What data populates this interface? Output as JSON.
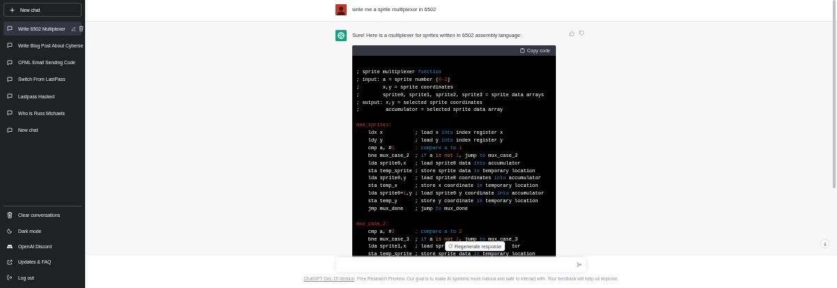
{
  "sidebar": {
    "new_chat_button": "New chat",
    "conversations": [
      {
        "title": "Write 6502 Multiplexer",
        "selected": true
      },
      {
        "title": "Write Blog Post About Cyberse",
        "selected": false
      },
      {
        "title": "CFML Email Sending Code",
        "selected": false
      },
      {
        "title": "Switch From LastPass",
        "selected": false
      },
      {
        "title": "Lastpass Hacked",
        "selected": false
      },
      {
        "title": "Who is Russ Michaels",
        "selected": false
      },
      {
        "title": "New chat",
        "selected": false
      }
    ],
    "footer_items": [
      {
        "label": "Clear conversations",
        "kind": "trash"
      },
      {
        "label": "Dark mode",
        "kind": "moon"
      },
      {
        "label": "OpenAI Discord",
        "kind": "discord"
      },
      {
        "label": "Updates & FAQ",
        "kind": "external"
      },
      {
        "label": "Log out",
        "kind": "logout"
      }
    ]
  },
  "messages": [
    {
      "kind": "user",
      "text": "write me a sprite multiplexor in 6502"
    },
    {
      "kind": "assistant",
      "text": "Sure! Here is a multiplexer for sprites written in 6502 assembly language:",
      "code": {
        "copy_label": "Copy code",
        "lines": [
          {
            "kind": "code",
            "segments": [
              {
                "text": "; sprite multiplexer ",
                "kind": "plain"
              },
              {
                "text": "function",
                "kind": "keyword"
              }
            ]
          },
          {
            "kind": "code",
            "segments": [
              {
                "text": "; input: a = sprite number (",
                "kind": "plain"
              },
              {
                "text": "0-3",
                "kind": "number"
              },
              {
                "text": ")",
                "kind": "plain"
              }
            ]
          },
          {
            "kind": "code",
            "segments": [
              {
                "text": ";        x,y = sprite coordinates",
                "kind": "plain"
              }
            ]
          },
          {
            "kind": "code",
            "segments": [
              {
                "text": ";        sprite0, sprite1, sprite2, sprite3 = sprite data arrays",
                "kind": "plain"
              }
            ]
          },
          {
            "kind": "code",
            "segments": [
              {
                "text": "; output: x,y = selected sprite coordinates",
                "kind": "plain"
              }
            ]
          },
          {
            "kind": "code",
            "segments": [
              {
                "text": ";         accumulator = selected sprite data array",
                "kind": "plain"
              }
            ]
          },
          {
            "kind": "blank"
          },
          {
            "kind": "code",
            "segments": [
              {
                "text": "mux_sprites:",
                "kind": "label"
              }
            ]
          },
          {
            "kind": "code",
            "segments": [
              {
                "text": "    ldx x           ; load x ",
                "kind": "plain"
              },
              {
                "text": "into",
                "kind": "keyword"
              },
              {
                "text": " index register x",
                "kind": "plain"
              }
            ]
          },
          {
            "kind": "code",
            "segments": [
              {
                "text": "    ldy y           ; load y ",
                "kind": "plain"
              },
              {
                "text": "into",
                "kind": "keyword"
              },
              {
                "text": " index register y",
                "kind": "plain"
              }
            ]
          },
          {
            "kind": "code",
            "segments": [
              {
                "text": "    cmp a, #",
                "kind": "plain"
              },
              {
                "text": "1",
                "kind": "number"
              },
              {
                "text": "       ; compare a to ",
                "kind": "keyword"
              },
              {
                "text": "1",
                "kind": "number"
              }
            ]
          },
          {
            "kind": "code",
            "segments": [
              {
                "text": "    bne mux_case_2  ; ",
                "kind": "plain"
              },
              {
                "text": "if",
                "kind": "keyword"
              },
              {
                "text": " a ",
                "kind": "plain"
              },
              {
                "text": "is not",
                "kind": "operator"
              },
              {
                "text": " 1",
                "kind": "number"
              },
              {
                "text": ", jump ",
                "kind": "plain"
              },
              {
                "text": "to",
                "kind": "keyword"
              },
              {
                "text": " mux_case_2",
                "kind": "plain"
              }
            ]
          },
          {
            "kind": "code",
            "segments": [
              {
                "text": "    lda sprite0,x   ; load sprite0 data ",
                "kind": "plain"
              },
              {
                "text": "into",
                "kind": "keyword"
              },
              {
                "text": " accumulator",
                "kind": "plain"
              }
            ]
          },
          {
            "kind": "code",
            "segments": [
              {
                "text": "    sta temp_sprite ; store sprite data ",
                "kind": "plain"
              },
              {
                "text": "in",
                "kind": "keyword"
              },
              {
                "text": " temporary location",
                "kind": "plain"
              }
            ]
          },
          {
            "kind": "code",
            "segments": [
              {
                "text": "    lda sprite0,y   ; load sprite0 coordinates ",
                "kind": "plain"
              },
              {
                "text": "into",
                "kind": "keyword"
              },
              {
                "text": " accumulator",
                "kind": "plain"
              }
            ]
          },
          {
            "kind": "code",
            "segments": [
              {
                "text": "    sta temp_x      ; store x coordinate ",
                "kind": "plain"
              },
              {
                "text": "in",
                "kind": "keyword"
              },
              {
                "text": " temporary location",
                "kind": "plain"
              }
            ]
          },
          {
            "kind": "code",
            "segments": [
              {
                "text": "    lda sprite0+",
                "kind": "plain"
              },
              {
                "text": "1",
                "kind": "number"
              },
              {
                "text": ",y ; load sprite0 y coordinate ",
                "kind": "plain"
              },
              {
                "text": "into",
                "kind": "keyword"
              },
              {
                "text": " accumulator",
                "kind": "plain"
              }
            ]
          },
          {
            "kind": "code",
            "segments": [
              {
                "text": "    sta temp_y      ; store y coordinate ",
                "kind": "plain"
              },
              {
                "text": "in",
                "kind": "keyword"
              },
              {
                "text": " temporary location",
                "kind": "plain"
              }
            ]
          },
          {
            "kind": "code",
            "segments": [
              {
                "text": "    jmp mux_done    ; jump ",
                "kind": "plain"
              },
              {
                "text": "to",
                "kind": "keyword"
              },
              {
                "text": " mux_done",
                "kind": "plain"
              }
            ]
          },
          {
            "kind": "blank"
          },
          {
            "kind": "code",
            "segments": [
              {
                "text": "mux_case_2:",
                "kind": "label"
              }
            ]
          },
          {
            "kind": "code",
            "segments": [
              {
                "text": "    cmp a, #",
                "kind": "plain"
              },
              {
                "text": "2",
                "kind": "number"
              },
              {
                "text": "       ; compare a to ",
                "kind": "keyword"
              },
              {
                "text": "2",
                "kind": "number"
              }
            ]
          },
          {
            "kind": "code",
            "segments": [
              {
                "text": "    bne mux_case_3  ; ",
                "kind": "plain"
              },
              {
                "text": "if",
                "kind": "keyword"
              },
              {
                "text": " a ",
                "kind": "plain"
              },
              {
                "text": "is not",
                "kind": "operator"
              },
              {
                "text": " 2",
                "kind": "number"
              },
              {
                "text": ", jump ",
                "kind": "plain"
              },
              {
                "text": "to",
                "kind": "keyword"
              },
              {
                "text": " mux_case_3",
                "kind": "plain"
              }
            ]
          },
          {
            "kind": "split",
            "segments": [
              {
                "text": "    lda sprite1,x   ; load spr",
                "kind": "plain"
              },
              {
                "text": "tor",
                "kind": "plain"
              }
            ]
          },
          {
            "kind": "code",
            "segments": [
              {
                "text": "    sta temp_sprite ; store sprite data ",
                "kind": "plain"
              },
              {
                "text": "in",
                "kind": "keyword"
              },
              {
                "text": " temporary location",
                "kind": "plain"
              }
            ]
          }
        ]
      }
    }
  ],
  "regenerate_button": "Regenerate response",
  "footer": {
    "link": "ChatGPT Dec 15 Version",
    "text": ". Free Research Preview. Our goal is to make AI systems more natural and safe to interact with. Your feedback will help us improve."
  }
}
